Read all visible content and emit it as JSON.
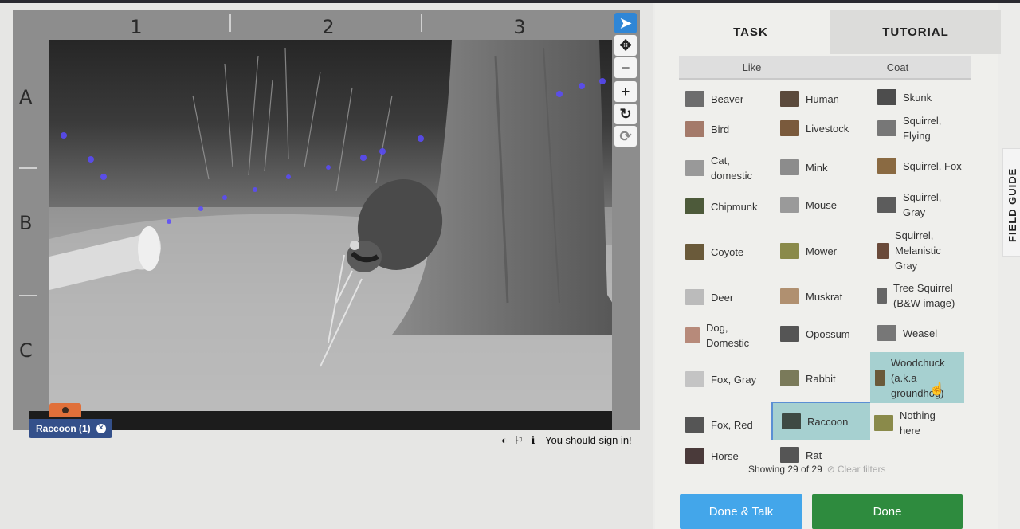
{
  "viewer": {
    "columns": [
      "1",
      "2",
      "3"
    ],
    "rows": [
      "A",
      "B",
      "C"
    ],
    "tools": [
      {
        "icon": "pointer-icon",
        "glyph": "➤",
        "active": true
      },
      {
        "icon": "move-icon",
        "glyph": "✥"
      },
      {
        "icon": "zoom-out-icon",
        "glyph": "−"
      },
      {
        "icon": "zoom-in-icon",
        "glyph": "+"
      },
      {
        "icon": "rotate-icon",
        "glyph": "↻"
      },
      {
        "icon": "reset-icon",
        "glyph": "⟳"
      }
    ],
    "selected_tag": {
      "label": "Raccoon (1)",
      "remove": "×"
    },
    "meta": {
      "invert_glyph": "◐",
      "flag_glyph": "⚐",
      "info_glyph": "ℹ",
      "sign_in": "You should sign in!"
    }
  },
  "panel": {
    "tabs": {
      "task": "TASK",
      "tutorial": "TUTORIAL"
    },
    "filters": [
      "Like",
      "Coat"
    ],
    "choices": [
      [
        "Beaver",
        "Human",
        "Skunk"
      ],
      [
        "Bird",
        "Livestock",
        "Squirrel, Flying"
      ],
      [
        "Cat, domestic",
        "Mink",
        "Squirrel, Fox"
      ],
      [
        "Chipmunk",
        "Mouse",
        "Squirrel, Gray"
      ],
      [
        "Coyote",
        "Mower",
        "Squirrel, Melanistic Gray"
      ],
      [
        "Deer",
        "Muskrat",
        "Tree Squirrel (B&W image)"
      ],
      [
        "Dog, Domestic",
        "Opossum",
        "Weasel"
      ],
      [
        "Fox, Gray",
        "Rabbit",
        "Woodchuck (a.k.a groundhog)"
      ],
      [
        "Fox, Red",
        "Raccoon",
        "Nothing here"
      ],
      [
        "Horse",
        "Rat"
      ]
    ],
    "choice_labels": {
      "beaver": "Beaver",
      "human": "Human",
      "skunk": "Skunk",
      "bird": "Bird",
      "livestock": "Livestock",
      "squirrel_flying_1": "Squirrel,",
      "squirrel_flying_2": "Flying",
      "cat_1": "Cat,",
      "cat_2": "domestic",
      "mink": "Mink",
      "squirrel_fox": "Squirrel, Fox",
      "chipmunk": "Chipmunk",
      "mouse": "Mouse",
      "squirrel_gray_1": "Squirrel,",
      "squirrel_gray_2": "Gray",
      "coyote": "Coyote",
      "mower": "Mower",
      "squirrel_mel_1": "Squirrel,",
      "squirrel_mel_2": "Melanistic",
      "squirrel_mel_3": "Gray",
      "deer": "Deer",
      "muskrat": "Muskrat",
      "tree_sq_1": "Tree Squirrel",
      "tree_sq_2": "(B&W image)",
      "dog_1": "Dog,",
      "dog_2": "Domestic",
      "opossum": "Opossum",
      "weasel": "Weasel",
      "fox_gray": "Fox, Gray",
      "rabbit": "Rabbit",
      "woodchuck_1": "Woodchuck",
      "woodchuck_2": "(a.k.a",
      "woodchuck_3": "groundhog)",
      "fox_red": "Fox, Red",
      "raccoon": "Raccoon",
      "nothing_1": "Nothing",
      "nothing_2": "here",
      "horse": "Horse",
      "rat": "Rat"
    },
    "showing": "Showing 29 of 29",
    "clear_filters": "Clear filters",
    "buttons": {
      "done_talk": "Done & Talk",
      "done": "Done"
    },
    "field_guide": "FIELD GUIDE"
  },
  "colors": {
    "selected_bg": "#a6d0d0",
    "done_talk": "#43a6ea",
    "done": "#2e8b3e",
    "tag_chip": "#34508a",
    "active_tool": "#2f86d6"
  }
}
